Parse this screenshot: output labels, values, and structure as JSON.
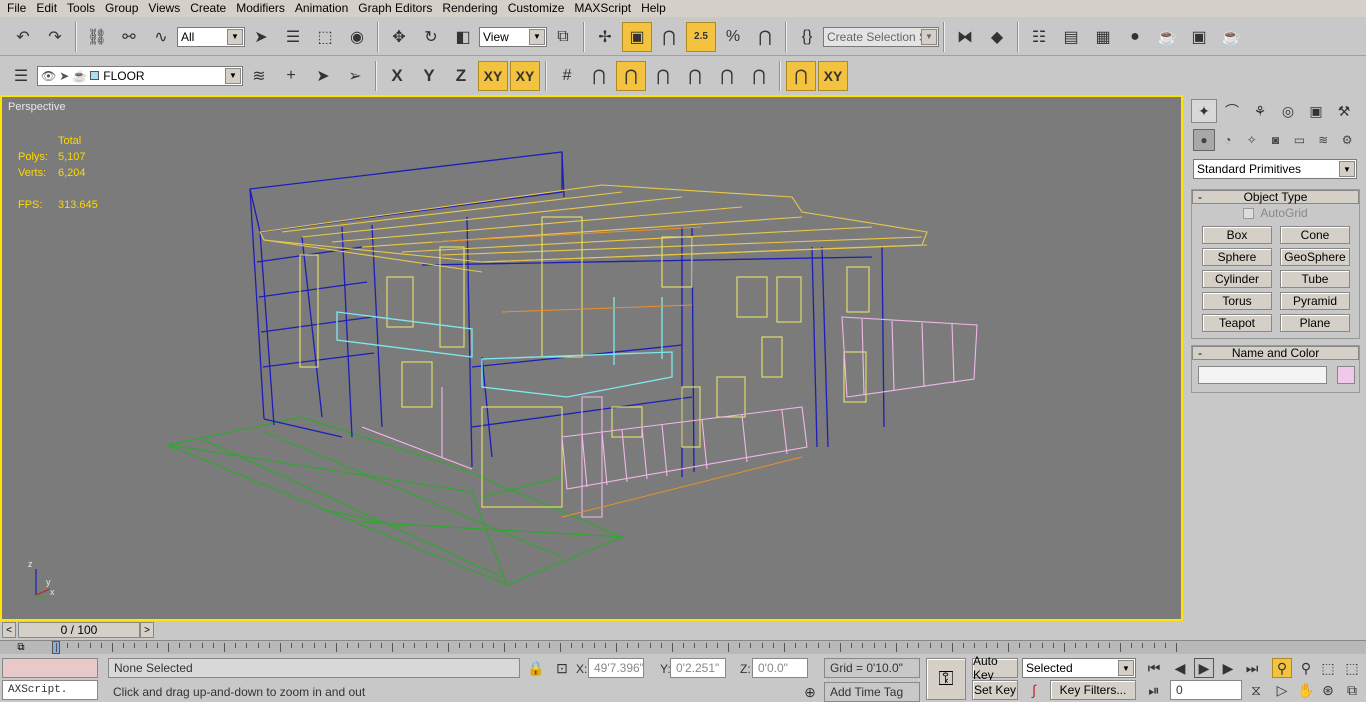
{
  "menu": [
    "File",
    "Edit",
    "Tools",
    "Group",
    "Views",
    "Create",
    "Modifiers",
    "Animation",
    "Graph Editors",
    "Rendering",
    "Customize",
    "MAXScript",
    "Help"
  ],
  "toolbar": {
    "selection_filter": "All",
    "ref_coord": "View",
    "snap_angle": "2.5",
    "named_selection_placeholder": "Create Selection Set"
  },
  "layer_bar": {
    "layer_name": "FLOOR",
    "axes": [
      "X",
      "Y",
      "Z",
      "XY",
      "XY"
    ]
  },
  "viewport": {
    "label": "Perspective",
    "stats": {
      "header": "Total",
      "polys_label": "Polys:",
      "polys": "5,107",
      "verts_label": "Verts:",
      "verts": "6,204",
      "fps_label": "FPS:",
      "fps": "313.645"
    },
    "axis_labels": {
      "z": "z",
      "x": "x",
      "y": "y"
    }
  },
  "command_panel": {
    "category": "Standard Primitives",
    "object_type_title": "Object Type",
    "autogrid_label": "AutoGrid",
    "primitives": [
      "Box",
      "Cone",
      "Sphere",
      "GeoSphere",
      "Cylinder",
      "Tube",
      "Torus",
      "Pyramid",
      "Teapot",
      "Plane"
    ],
    "name_color_title": "Name and Color",
    "name_value": "",
    "swatch_color": "#f0c8e8"
  },
  "time_slider": {
    "frame_label": "0 / 100",
    "progress": 0
  },
  "status": {
    "maxscript_listener": "AXScript.",
    "selection": "None Selected",
    "prompt": "Click and drag up-and-down to zoom in and out",
    "x_label": "X:",
    "x_value": "49'7.396\"",
    "y_label": "Y:",
    "y_value": "0'2.251\"",
    "z_label": "Z:",
    "z_value": "0'0.0\"",
    "grid": "Grid = 0'10.0\"",
    "add_time_tag": "Add Time Tag",
    "auto_key": "Auto Key",
    "set_key": "Set Key",
    "key_mode": "Selected",
    "key_filters": "Key Filters...",
    "current_frame": "0"
  },
  "colors": {
    "viewport_bg": "#7b7b7b",
    "active_border": "#ffe600",
    "stats_text": "#ffd700",
    "active_button": "#f3c23e"
  }
}
